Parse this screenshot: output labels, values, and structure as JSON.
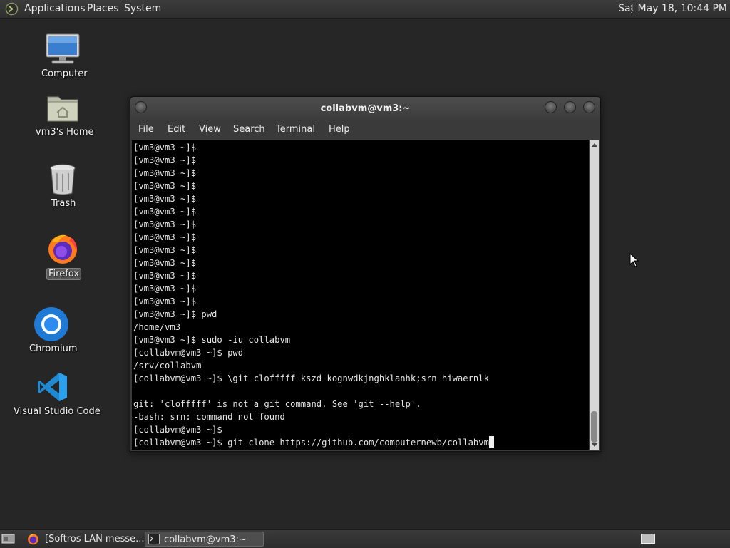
{
  "top_panel": {
    "menus": [
      "Applications",
      "Places",
      "System"
    ],
    "clock": "Sat May 18, 10:44 PM"
  },
  "desktop": {
    "icons": [
      {
        "label": "Computer",
        "icon": "computer-icon"
      },
      {
        "label": "vm3's Home",
        "icon": "home-folder-icon"
      },
      {
        "label": "Trash",
        "icon": "trash-icon"
      },
      {
        "label": "Firefox",
        "icon": "firefox-icon"
      },
      {
        "label": "Chromium",
        "icon": "chromium-icon"
      },
      {
        "label": "Visual Studio Code",
        "icon": "vscode-icon"
      }
    ]
  },
  "terminal_window": {
    "title": "collabvm@vm3:~",
    "menu": [
      "File",
      "Edit",
      "View",
      "Search",
      "Terminal",
      "Help"
    ],
    "lines": [
      "[vm3@vm3 ~]$",
      "[vm3@vm3 ~]$",
      "[vm3@vm3 ~]$",
      "[vm3@vm3 ~]$",
      "[vm3@vm3 ~]$",
      "[vm3@vm3 ~]$",
      "[vm3@vm3 ~]$",
      "[vm3@vm3 ~]$",
      "[vm3@vm3 ~]$",
      "[vm3@vm3 ~]$",
      "[vm3@vm3 ~]$",
      "[vm3@vm3 ~]$",
      "[vm3@vm3 ~]$",
      "[vm3@vm3 ~]$ pwd",
      "/home/vm3",
      "[vm3@vm3 ~]$ sudo -iu collabvm",
      "[collabvm@vm3 ~]$ pwd",
      "/srv/collabvm",
      "[collabvm@vm3 ~]$ \\git clofffff kszd kognwdkjnghklanhk;srn hiwaernlk",
      "",
      "git: 'clofffff' is not a git command. See 'git --help'.",
      "-bash: srn: command not found",
      "[collabvm@vm3 ~]$",
      "[collabvm@vm3 ~]$ git clone https://github.com/computernewb/collabvm"
    ]
  },
  "taskbar": {
    "tasks": [
      {
        "label": "[Softros LAN messe...",
        "icon": "firefox-icon",
        "active": false
      },
      {
        "label": "collabvm@vm3:~",
        "icon": "terminal-icon",
        "active": true
      }
    ]
  }
}
